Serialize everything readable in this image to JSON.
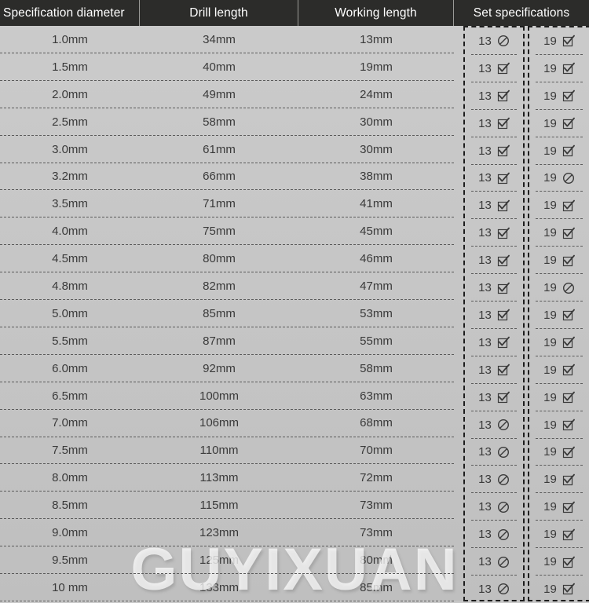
{
  "table": {
    "headers": [
      "Specification diameter",
      "Drill length",
      "Working length",
      "Set specifications"
    ],
    "set_columns": [
      {
        "label": "13"
      },
      {
        "label": "19"
      }
    ],
    "rows": [
      {
        "spec": "1.0mm",
        "drill": "34mm",
        "work": "13mm",
        "set13": "prohibited-icon",
        "set19": "checked-icon"
      },
      {
        "spec": "1.5mm",
        "drill": "40mm",
        "work": "19mm",
        "set13": "checked-icon",
        "set19": "checked-icon"
      },
      {
        "spec": "2.0mm",
        "drill": "49mm",
        "work": "24mm",
        "set13": "checked-icon",
        "set19": "checked-icon"
      },
      {
        "spec": "2.5mm",
        "drill": "58mm",
        "work": "30mm",
        "set13": "checked-icon",
        "set19": "checked-icon"
      },
      {
        "spec": "3.0mm",
        "drill": "61mm",
        "work": "30mm",
        "set13": "checked-icon",
        "set19": "checked-icon"
      },
      {
        "spec": "3.2mm",
        "drill": "66mm",
        "work": "38mm",
        "set13": "checked-icon",
        "set19": "prohibited-icon"
      },
      {
        "spec": "3.5mm",
        "drill": "71mm",
        "work": "41mm",
        "set13": "checked-icon",
        "set19": "checked-icon"
      },
      {
        "spec": "4.0mm",
        "drill": "75mm",
        "work": "45mm",
        "set13": "checked-icon",
        "set19": "checked-icon"
      },
      {
        "spec": "4.5mm",
        "drill": "80mm",
        "work": "46mm",
        "set13": "checked-icon",
        "set19": "checked-icon"
      },
      {
        "spec": "4.8mm",
        "drill": "82mm",
        "work": "47mm",
        "set13": "checked-icon",
        "set19": "prohibited-icon"
      },
      {
        "spec": "5.0mm",
        "drill": "85mm",
        "work": "53mm",
        "set13": "checked-icon",
        "set19": "checked-icon"
      },
      {
        "spec": "5.5mm",
        "drill": "87mm",
        "work": "55mm",
        "set13": "checked-icon",
        "set19": "checked-icon"
      },
      {
        "spec": "6.0mm",
        "drill": "92mm",
        "work": "58mm",
        "set13": "checked-icon",
        "set19": "checked-icon"
      },
      {
        "spec": "6.5mm",
        "drill": "100mm",
        "work": "63mm",
        "set13": "checked-icon",
        "set19": "checked-icon"
      },
      {
        "spec": "7.0mm",
        "drill": "106mm",
        "work": "68mm",
        "set13": "prohibited-icon",
        "set19": "checked-icon"
      },
      {
        "spec": "7.5mm",
        "drill": "110mm",
        "work": "70mm",
        "set13": "prohibited-icon",
        "set19": "checked-icon"
      },
      {
        "spec": "8.0mm",
        "drill": "113mm",
        "work": "72mm",
        "set13": "prohibited-icon",
        "set19": "checked-icon"
      },
      {
        "spec": "8.5mm",
        "drill": "115mm",
        "work": "73mm",
        "set13": "prohibited-icon",
        "set19": "checked-icon"
      },
      {
        "spec": "9.0mm",
        "drill": "123mm",
        "work": "73mm",
        "set13": "prohibited-icon",
        "set19": "checked-icon"
      },
      {
        "spec": "9.5mm",
        "drill": "125mm",
        "work": "80mm",
        "set13": "prohibited-icon",
        "set19": "checked-icon"
      },
      {
        "spec": "10 mm",
        "drill": "133mm",
        "work": "85mm",
        "set13": "prohibited-icon",
        "set19": "checked-icon"
      }
    ]
  },
  "watermark": {
    "text": "GUYIXUAN"
  },
  "colors": {
    "header_bg": "#2c2c2a",
    "header_text": "#ffffff",
    "body_bg": "#c8c8c8",
    "body_text": "#3a3a3a",
    "separator": "#5b5b5b",
    "setbox_border": "#1d1d1d",
    "watermark": "#ffffff"
  }
}
